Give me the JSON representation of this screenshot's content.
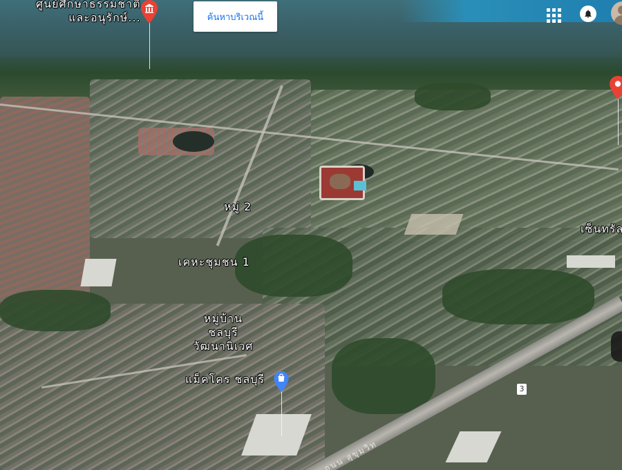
{
  "map": {
    "view": "satellite-3d",
    "places": {
      "museum": {
        "line1": "ศูนย์ศึกษาธรรมชาติ",
        "line2": "และอนุรักษ์...",
        "icon": "museum-icon"
      },
      "moo2": "หมู่ 2",
      "community1": "เคหะชุมชน 1",
      "village": {
        "line1": "หมู่บ้าน",
        "line2": "ชลบุรี",
        "line3": "วัฒนานิเวศ"
      },
      "central": "เซ็นทรัลพ",
      "makro": {
        "name": "แม็คโคร ชลบุรี",
        "icon": "shopping-bag-icon"
      },
      "sukhumvit": "ถนน สุขุมวิท"
    },
    "route_shield": "3",
    "pin_colors": {
      "red": "#e94235",
      "blue": "#4285f4"
    }
  },
  "toolbar": {
    "search_area_label": "ค้นหาบริเวณนี้",
    "apps_icon": "apps-grid-icon",
    "notifications_icon": "bell-icon",
    "account_icon": "account-avatar"
  }
}
